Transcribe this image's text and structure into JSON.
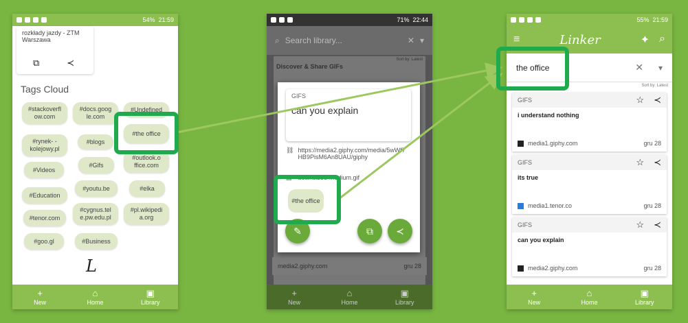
{
  "colors": {
    "bg": "#79b641",
    "primary": "#8cbf4f",
    "chip": "#dfe8c9",
    "highlight": "#1faa4e",
    "arrow": "#9cc85f"
  },
  "phone1": {
    "status": {
      "battery": "54%",
      "time": "21:59"
    },
    "top_card": {
      "text": "rozkłady jazdy - ZTM Warszawa",
      "copy_icon": "copy-icon",
      "share_icon": "share-icon"
    },
    "tags_title": "Tags Cloud",
    "tags": [
      "#stackoverfl ow.com",
      "#docs.goog le.com",
      "#Undefined",
      "#the office",
      "#rynek- -kolejowy.pl",
      "#blogs",
      "#outlook.o ffice.com",
      "#Videos",
      "#Gifs",
      "#Education",
      "#youtu.be",
      "#elka",
      "#tenor.com",
      "#cygnus.tel e.pw.edu.pl",
      "#pl.wikipedi a.org",
      "#goo.gl",
      "#Business"
    ],
    "logo": "L"
  },
  "phone2": {
    "status": {
      "battery": "71%",
      "time": "22:44"
    },
    "search_placeholder": "Search library...",
    "sort": "Sort by: Latest",
    "under_header": "Discover & Share GIFs",
    "dialog": {
      "label": "GIFS",
      "title": "can you explain",
      "url": "https://media2.giphy.com/media/5wWf7HB9PisM6An8UAU/giphy",
      "file": "-downsized-medium.gif",
      "chip": "#the office"
    },
    "bottom_row": {
      "domain": "media2.giphy.com",
      "date": "gru 28"
    }
  },
  "phone3": {
    "status": {
      "battery": "55%",
      "time": "21:59"
    },
    "brand": "Linker",
    "query": "the office",
    "sort": "Sort by: Latest",
    "cards": [
      {
        "label": "GIFS",
        "title": "i understand nothing",
        "domain": "media1.giphy.com",
        "date": "gru 28",
        "fav": "#222222"
      },
      {
        "label": "GIFS",
        "title": "its true",
        "domain": "media1.tenor.co",
        "date": "gru 28",
        "fav": "#2b7bd8"
      },
      {
        "label": "GIFS",
        "title": "can you explain",
        "domain": "media2.giphy.com",
        "date": "gru 28",
        "fav": "#222222"
      }
    ]
  },
  "nav": {
    "new": "New",
    "home": "Home",
    "library": "Library"
  }
}
